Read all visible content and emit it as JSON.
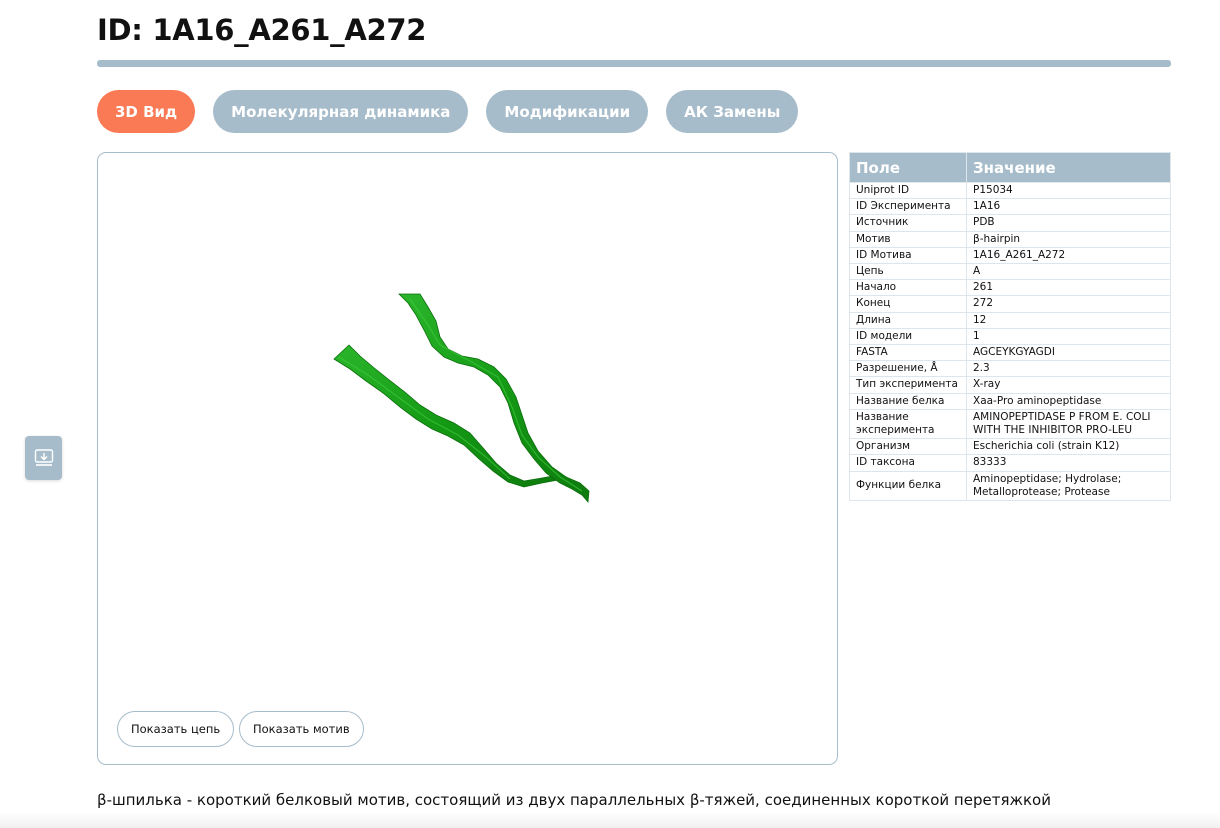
{
  "page": {
    "title": "ID: 1A16_A261_A272"
  },
  "tabs": [
    {
      "label": "3D Вид",
      "active": true
    },
    {
      "label": "Молекулярная динамика",
      "active": false
    },
    {
      "label": "Модификации",
      "active": false
    },
    {
      "label": "АК Замены",
      "active": false
    }
  ],
  "viewer": {
    "structure_color": "#1f9a1f",
    "buttons": {
      "show_chain": "Показать цепь",
      "show_motif": "Показать мотив"
    }
  },
  "side_tool": {
    "icon": "download-icon"
  },
  "info_table": {
    "headers": [
      "Поле",
      "Значение"
    ],
    "rows": [
      [
        "Uniprot ID",
        "P15034"
      ],
      [
        "ID Эксперимента",
        "1A16"
      ],
      [
        "Источник",
        "PDB"
      ],
      [
        "Мотив",
        "β-hairpin"
      ],
      [
        "ID Мотива",
        "1A16_A261_A272"
      ],
      [
        "Цепь",
        "A"
      ],
      [
        "Начало",
        "261"
      ],
      [
        "Конец",
        "272"
      ],
      [
        "Длина",
        "12"
      ],
      [
        "ID модели",
        "1"
      ],
      [
        "FASTA",
        "AGCEYKGYAGDI"
      ],
      [
        "Разрешение, Å",
        "2.3"
      ],
      [
        "Тип эксперимента",
        "X-ray"
      ],
      [
        "Название белка",
        "Xaa-Pro aminopeptidase"
      ],
      [
        "Название эксперимента",
        "AMINOPEPTIDASE P FROM E. COLI WITH THE INHIBITOR PRO-LEU"
      ],
      [
        "Организм",
        "Escherichia coli (strain K12)"
      ],
      [
        "ID таксона",
        "83333"
      ],
      [
        "Функции белка",
        "Aminopeptidase; Hydrolase; Metalloprotease; Protease"
      ]
    ]
  },
  "description": "β-шпилька - короткий белковый мотив, состоящий из двух параллельных β-тяжей, соединенных короткой перетяжкой",
  "colors": {
    "accent": "#fa7a55",
    "muted": "#a7bcca"
  }
}
